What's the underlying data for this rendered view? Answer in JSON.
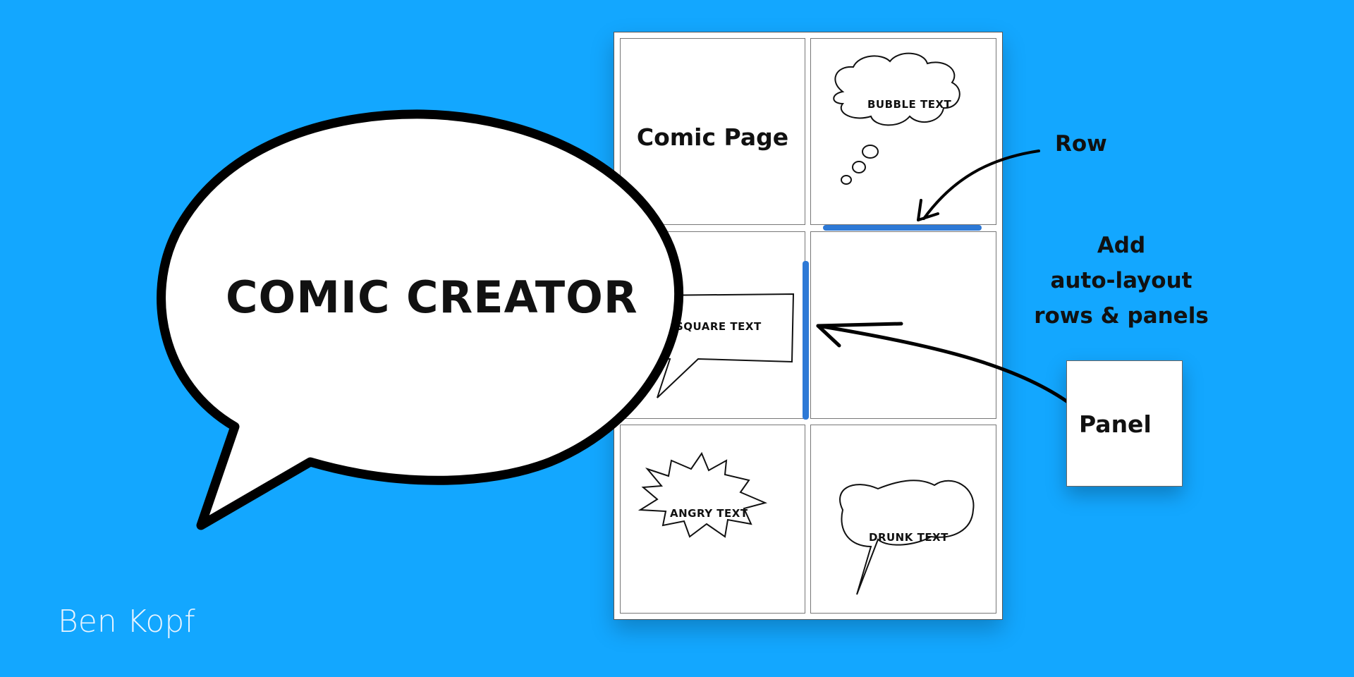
{
  "title": "COMIC CREATOR",
  "credit": "Ben Kopf",
  "panels": {
    "comic_page": "Comic Page",
    "bubble": "BUBBLE TEXT",
    "square": "SQUARE TEXT",
    "angry": "ANGRY TEXT",
    "drunk": "DRUNK TEXT"
  },
  "annotations": {
    "row": "Row",
    "add_line1": "Add",
    "add_line2": "auto-layout",
    "add_line3": "rows & panels",
    "panel": "Panel"
  },
  "colors": {
    "background": "#13a7ff",
    "handle": "#2d79d6"
  }
}
